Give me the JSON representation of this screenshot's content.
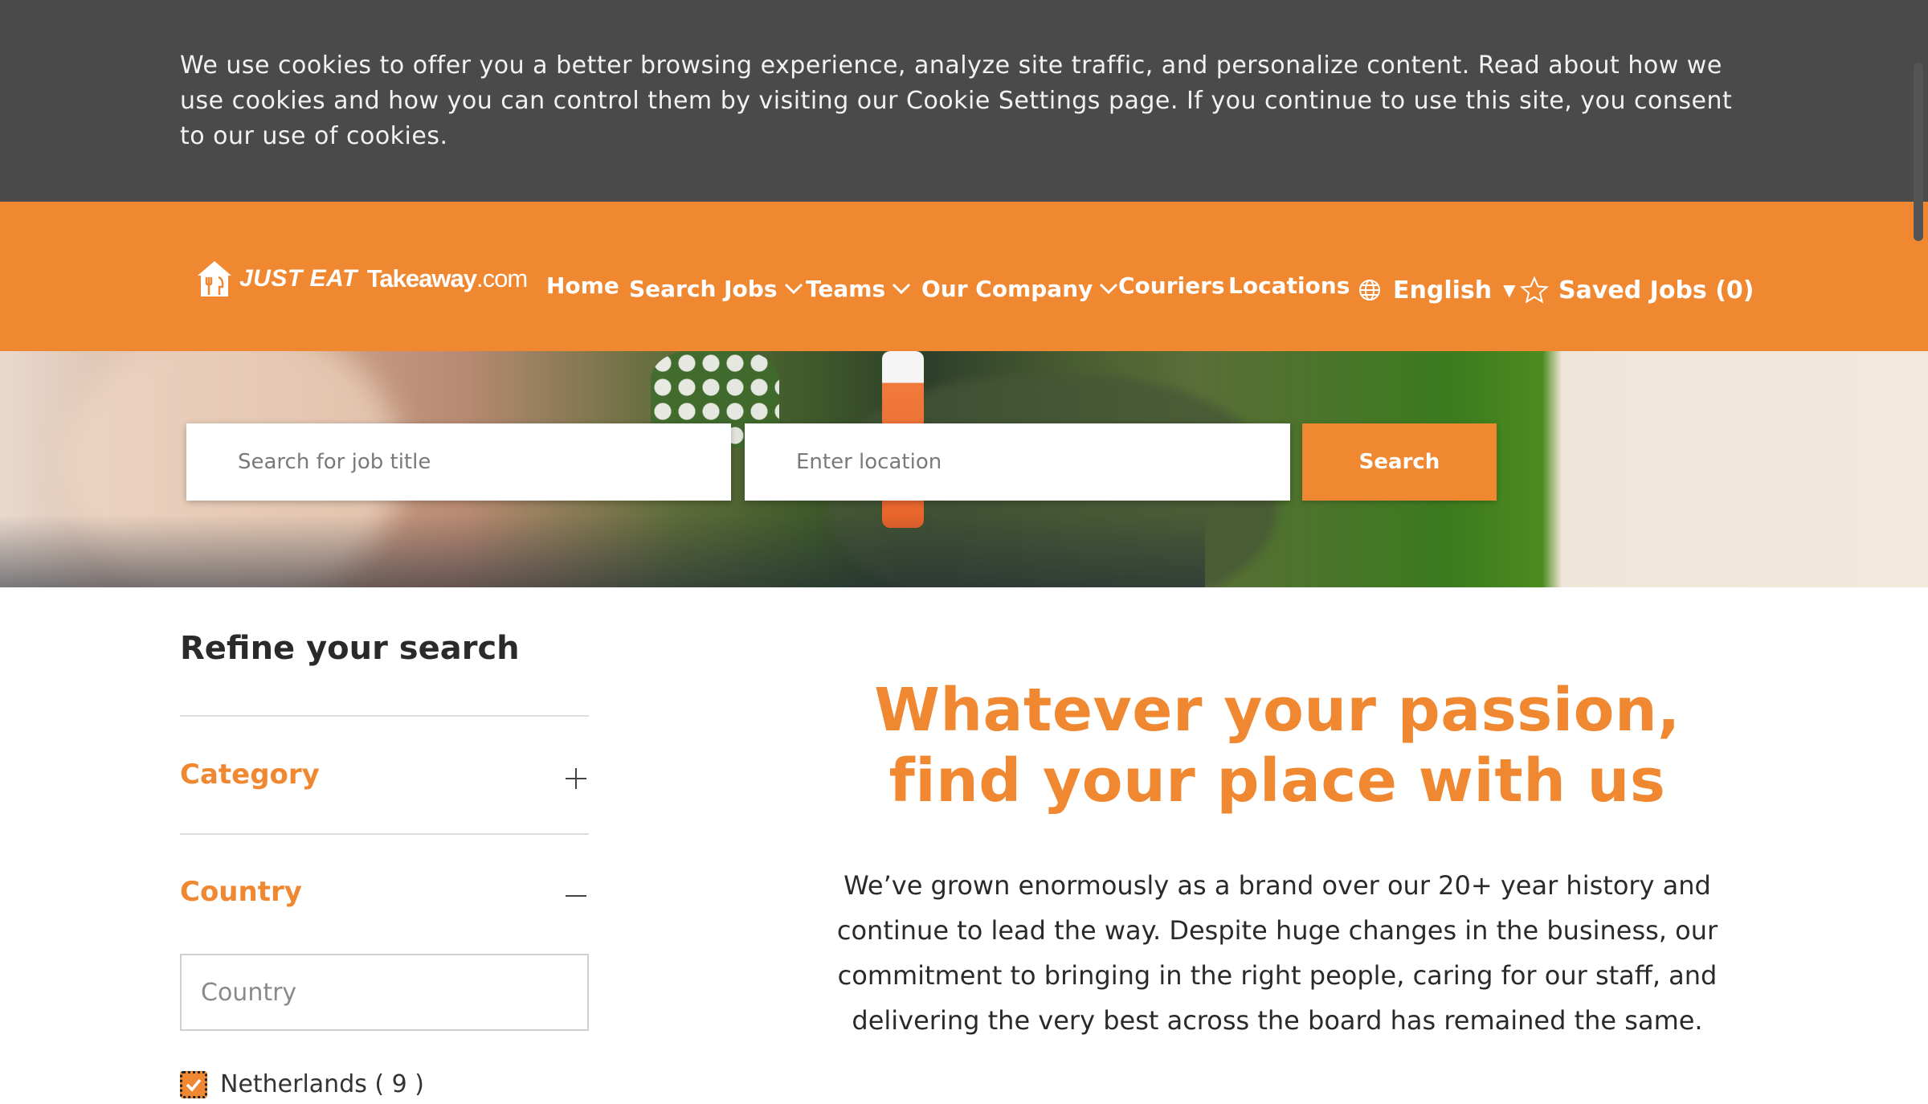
{
  "cookie_banner": {
    "text": "We use cookies to offer you a better browsing experience, analyze site traffic, and personalize content. Read about how we use cookies and how you can control them by visiting our Cookie Settings page. If you continue to use this site, you consent to our use of cookies."
  },
  "header": {
    "logo": {
      "brand": "JUST EAT",
      "name": "Takeaway",
      "suffix": ".com"
    },
    "nav": {
      "home": "Home",
      "search_jobs": "Search Jobs",
      "teams": "Teams",
      "our_company": "Our Company",
      "couriers": "Couriers",
      "locations": "Locations"
    },
    "language": "English",
    "saved_jobs": "Saved Jobs (0)"
  },
  "search": {
    "job_placeholder": "Search for job title",
    "location_placeholder": "Enter location",
    "button": "Search"
  },
  "sidebar": {
    "title": "Refine your search",
    "facets": [
      {
        "label": "Category",
        "state": "collapsed"
      },
      {
        "label": "Country",
        "state": "expanded"
      }
    ],
    "country_placeholder": "Country",
    "options": [
      {
        "label": "Netherlands ( 9 )",
        "checked": true
      }
    ]
  },
  "main": {
    "headline_line1": "Whatever your passion,",
    "headline_line2": "find your place with us",
    "paragraph": "We’ve grown enormously as a brand over our 20+ year history and continue to lead the way. Despite huge changes in the business, our commitment to bringing in the right people, caring for our staff, and delivering the very best across the board has remained the same."
  },
  "colors": {
    "brand_orange": "#f08832",
    "cookie_bg": "#4a4a4a",
    "text_dark": "#2a2a2a"
  },
  "icons": [
    "logo-house-icon",
    "chevron-down-icon",
    "globe-icon",
    "caret-down-icon",
    "star-icon",
    "plus-icon",
    "minus-icon",
    "checkmark-icon"
  ]
}
